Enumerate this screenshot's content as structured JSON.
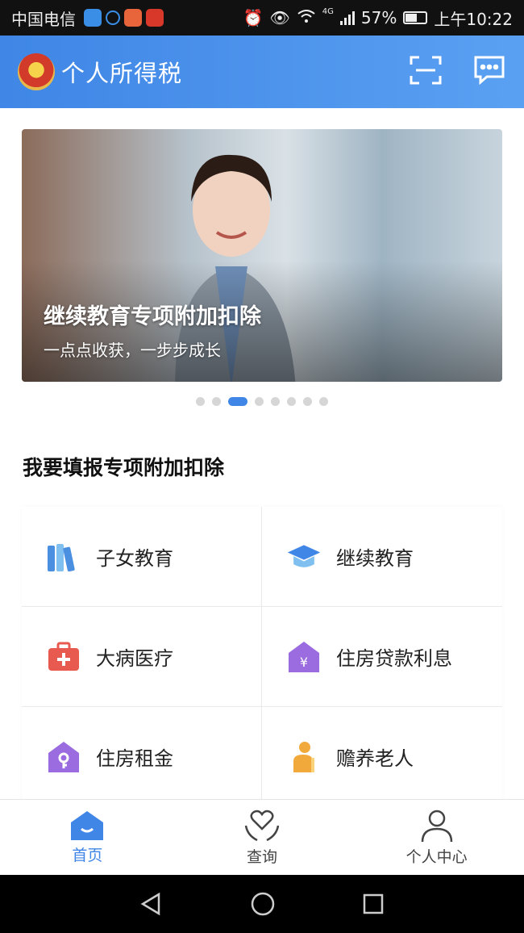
{
  "status_bar": {
    "carrier": "中国电信",
    "battery": "57%",
    "network": "4G",
    "time": "上午10:22",
    "battery_level": 0.57
  },
  "header": {
    "title": "个人所得税",
    "icons": [
      "emblem-icon",
      "scan-icon",
      "message-icon"
    ]
  },
  "banner": {
    "title": "继续教育专项附加扣除",
    "subtitle": "一点点收获，一步步成长",
    "slide_count": 8,
    "active_index": 2
  },
  "section": {
    "title": "我要填报专项附加扣除"
  },
  "deductions": [
    {
      "label": "子女教育",
      "icon": "books-icon",
      "color": "#5aa6e8"
    },
    {
      "label": "继续教育",
      "icon": "graduation-cap-icon",
      "color": "#4a9de0"
    },
    {
      "label": "大病医疗",
      "icon": "medical-kit-icon",
      "color": "#e85a4f"
    },
    {
      "label": "住房贷款利息",
      "icon": "house-yuan-icon",
      "color": "#9b6be0"
    },
    {
      "label": "住房租金",
      "icon": "house-key-icon",
      "color": "#9b6be0"
    },
    {
      "label": "赡养老人",
      "icon": "elder-icon",
      "color": "#f2a93b"
    }
  ],
  "tabs": [
    {
      "label": "首页",
      "icon": "home-icon",
      "active": true
    },
    {
      "label": "查询",
      "icon": "heart-hands-icon",
      "active": false
    },
    {
      "label": "个人中心",
      "icon": "person-icon",
      "active": false
    }
  ],
  "colors": {
    "accent": "#3f86e6",
    "header_start": "#3f86e6",
    "header_end": "#5aa0f2"
  }
}
